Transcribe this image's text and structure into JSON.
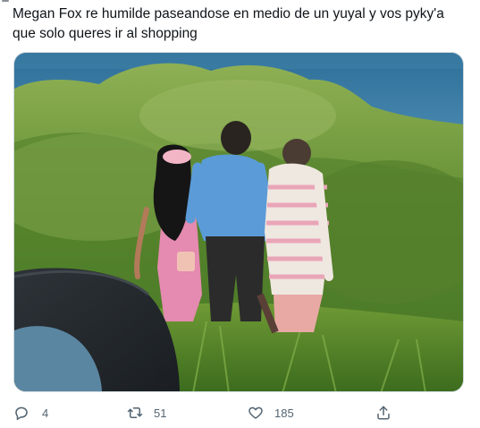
{
  "tweet": {
    "text": "Megan Fox re humilde paseandose en medio de un yuyal y vos pyky'a que solo queres ir al shopping"
  },
  "media": {
    "alt_icon": "photo"
  },
  "actions": {
    "reply": {
      "icon": "reply-icon",
      "count": "4"
    },
    "retweet": {
      "icon": "retweet-icon",
      "count": "51"
    },
    "like": {
      "icon": "heart-icon",
      "count": "185"
    },
    "share": {
      "icon": "share-icon"
    }
  },
  "colors": {
    "text": "#0f1419",
    "secondary": "#536471",
    "border": "#cfd9de"
  }
}
